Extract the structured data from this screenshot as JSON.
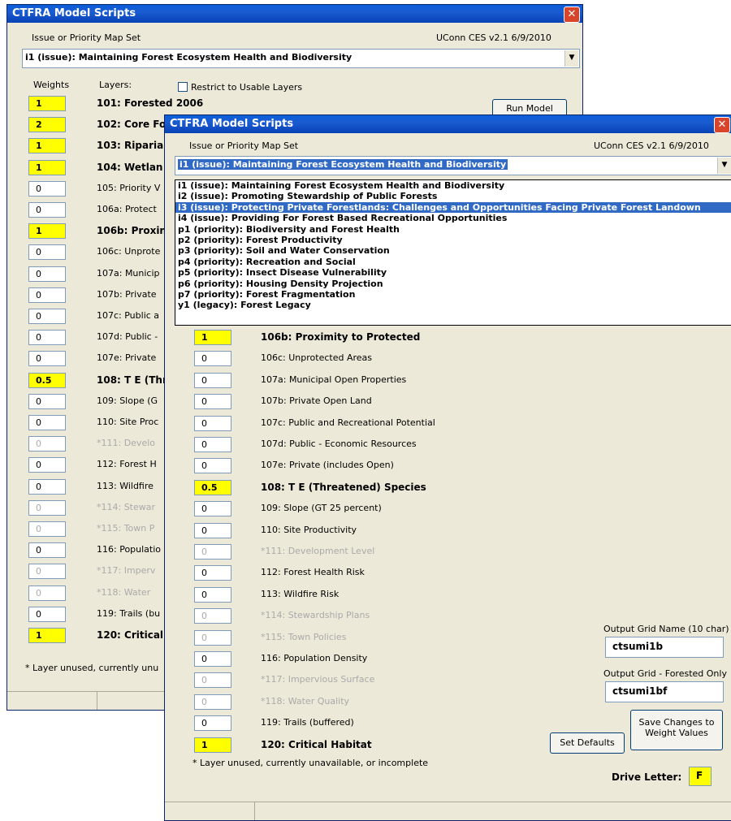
{
  "back_window": {
    "title": "CTFRA Model Scripts",
    "close_label": "✕",
    "issue_label": "Issue or Priority Map Set",
    "version": "UConn CES v2.1  6/9/2010",
    "selected": "i1 (issue): Maintaining Forest Ecosystem Health and Biodiversity",
    "weights_label": "Weights",
    "layers_label": "Layers:",
    "restrict_label": "Restrict to Usable Layers",
    "run_model": "Run Model",
    "rows": [
      {
        "w": "1",
        "l": "101: Forested 2006"
      },
      {
        "w": "2",
        "l": "102: Core Fo"
      },
      {
        "w": "1",
        "l": "103: Riparia"
      },
      {
        "w": "1",
        "l": "104: Wetlan"
      },
      {
        "w": "0",
        "l": "105: Priority V"
      },
      {
        "w": "0",
        "l": "106a: Protect"
      },
      {
        "w": "1",
        "l": "106b: Proxin"
      },
      {
        "w": "0",
        "l": "106c: Unprote"
      },
      {
        "w": "0",
        "l": "107a: Municip"
      },
      {
        "w": "0",
        "l": "107b: Private"
      },
      {
        "w": "0",
        "l": "107c: Public a"
      },
      {
        "w": "0",
        "l": "107d: Public -"
      },
      {
        "w": "0",
        "l": "107e: Private"
      },
      {
        "w": "0.5",
        "l": "108: T E (Thr"
      },
      {
        "w": "0",
        "l": "109: Slope (G"
      },
      {
        "w": "0",
        "l": "110: Site Proc"
      },
      {
        "w": "0",
        "l": "*111: Develo"
      },
      {
        "w": "0",
        "l": "112: Forest H"
      },
      {
        "w": "0",
        "l": "113: Wildfire"
      },
      {
        "w": "0",
        "l": "*114: Stewar"
      },
      {
        "w": "0",
        "l": "*115: Town P"
      },
      {
        "w": "0",
        "l": "116: Populatio"
      },
      {
        "w": "0",
        "l": "*117: Imperv"
      },
      {
        "w": "0",
        "l": "*118: Water"
      },
      {
        "w": "0",
        "l": "119: Trails (bu"
      },
      {
        "w": "1",
        "l": "120: Critical"
      }
    ],
    "footnote": "* Layer unused, currently unu"
  },
  "front_window": {
    "title": "CTFRA Model Scripts",
    "close_label": "✕",
    "issue_label": "Issue or Priority Map Set",
    "version": "UConn CES v2.1  6/9/2010",
    "selected": "i1 (issue): Maintaining Forest Ecosystem Health and Biodiversity",
    "dropdown_items": [
      "i1 (issue): Maintaining Forest Ecosystem Health and Biodiversity",
      "i2 (issue): Promoting Stewardship of Public Forests",
      "i3 (issue): Protecting Private Forestlands:  Challenges and Opportunities Facing Private Forest Landown",
      "i4 (issue): Providing For Forest Based Recreational Opportunities",
      "p1 (priority): Biodiversity and Forest Health",
      "p2 (priority): Forest Productivity",
      "p3 (priority): Soil and Water Conservation",
      "p4 (priority): Recreation and Social",
      "p5 (priority): Insect Disease Vulnerability",
      "p6 (priority): Housing Density Projection",
      "p7 (priority): Forest Fragmentation",
      "y1 (legacy): Forest Legacy"
    ],
    "rows": [
      {
        "w": "1",
        "l": "106b: Proximity to Protected"
      },
      {
        "w": "0",
        "l": "106c: Unprotected Areas"
      },
      {
        "w": "0",
        "l": "107a: Municipal Open Properties"
      },
      {
        "w": "0",
        "l": "107b: Private Open Land"
      },
      {
        "w": "0",
        "l": "107c: Public and Recreational Potential"
      },
      {
        "w": "0",
        "l": "107d: Public - Economic Resources"
      },
      {
        "w": "0",
        "l": "107e: Private (includes Open)"
      },
      {
        "w": "0.5",
        "l": "108: T E (Threatened) Species"
      },
      {
        "w": "0",
        "l": "109: Slope (GT 25 percent)"
      },
      {
        "w": "0",
        "l": "110: Site Productivity"
      },
      {
        "w": "0",
        "l": "*111: Development Level"
      },
      {
        "w": "0",
        "l": "112: Forest Health Risk"
      },
      {
        "w": "0",
        "l": "113: Wildfire Risk"
      },
      {
        "w": "0",
        "l": "*114: Stewardship Plans"
      },
      {
        "w": "0",
        "l": "*115: Town Policies"
      },
      {
        "w": "0",
        "l": "116: Population Density"
      },
      {
        "w": "0",
        "l": "*117: Impervious Surface"
      },
      {
        "w": "0",
        "l": "*118: Water Quality"
      },
      {
        "w": "0",
        "l": "119: Trails (buffered)"
      },
      {
        "w": "1",
        "l": "120: Critical Habitat"
      }
    ],
    "footnote": "* Layer unused, currently unavailable, or incomplete",
    "output_grid_label": "Output Grid Name (10 char)",
    "output_grid_value": "ctsumi1b",
    "output_forested_label": "Output Grid - Forested Only",
    "output_forested_value": "ctsumi1bf",
    "save_label_1": "Save Changes to",
    "save_label_2": "Weight Values",
    "set_defaults": "Set Defaults",
    "drive_label": "Drive Letter:",
    "drive_value": "F"
  }
}
